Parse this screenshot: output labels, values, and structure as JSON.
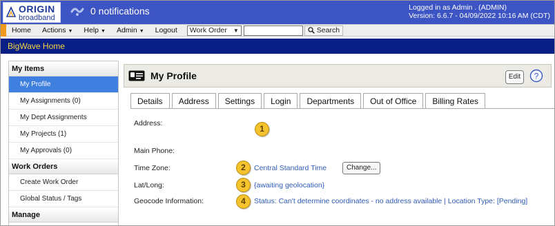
{
  "header": {
    "logo_text_top": "ORIGIN",
    "logo_text_bottom": "broadband",
    "notifications": "0 notifications",
    "user_line": "Logged in as Admin . (ADMIN)",
    "version_line": "Version: 6.6.7 - 04/09/2022 10:16 AM (CDT)"
  },
  "menu": {
    "items": [
      "Home",
      "Actions",
      "Help",
      "Admin",
      "Logout"
    ],
    "select_value": "Work Order",
    "search_label": "Search"
  },
  "section_title": "BigWave Home",
  "sidebar": {
    "sections": [
      {
        "title": "My Items",
        "items": [
          "My Profile",
          "My Assignments (0)",
          "My Dept Assignments",
          "My Projects (1)",
          "My Approvals (0)"
        ]
      },
      {
        "title": "Work Orders",
        "items": [
          "Create Work Order",
          "Global Status / Tags"
        ]
      },
      {
        "title": "Manage",
        "items": []
      }
    ],
    "active_item": "My Profile"
  },
  "panel": {
    "title": "My Profile",
    "edit_label": "Edit",
    "help_glyph": "?"
  },
  "tabs": [
    "Details",
    "Address",
    "Settings",
    "Login",
    "Departments",
    "Out of Office",
    "Billing Rates"
  ],
  "active_tab": "Address",
  "fields": {
    "address_label": "Address:",
    "main_phone_label": "Main Phone:",
    "time_zone_label": "Time Zone:",
    "time_zone_value": "Central Standard Time",
    "change_label": "Change...",
    "latlong_label": "Lat/Long:",
    "latlong_value": "{awaiting geolocation}",
    "geocode_label": "Geocode Information:",
    "geocode_value": "Status: Can't determine coordinates - no address available | Location Type: [Pending]"
  },
  "callouts": [
    "1",
    "2",
    "3",
    "4"
  ],
  "colors": {
    "topbar": "#3d55c4",
    "sectionbar": "#0a1f86",
    "section_text": "#f5d742",
    "active_side": "#3f7fe0",
    "link": "#2e5bb8",
    "callout": "#f5c32c",
    "menu_accent": "#f29a1e"
  },
  "icons": [
    "origin-logo-icon",
    "notification-icon",
    "search-icon",
    "id-card-icon",
    "help-icon",
    "dropdown-caret-icon"
  ]
}
